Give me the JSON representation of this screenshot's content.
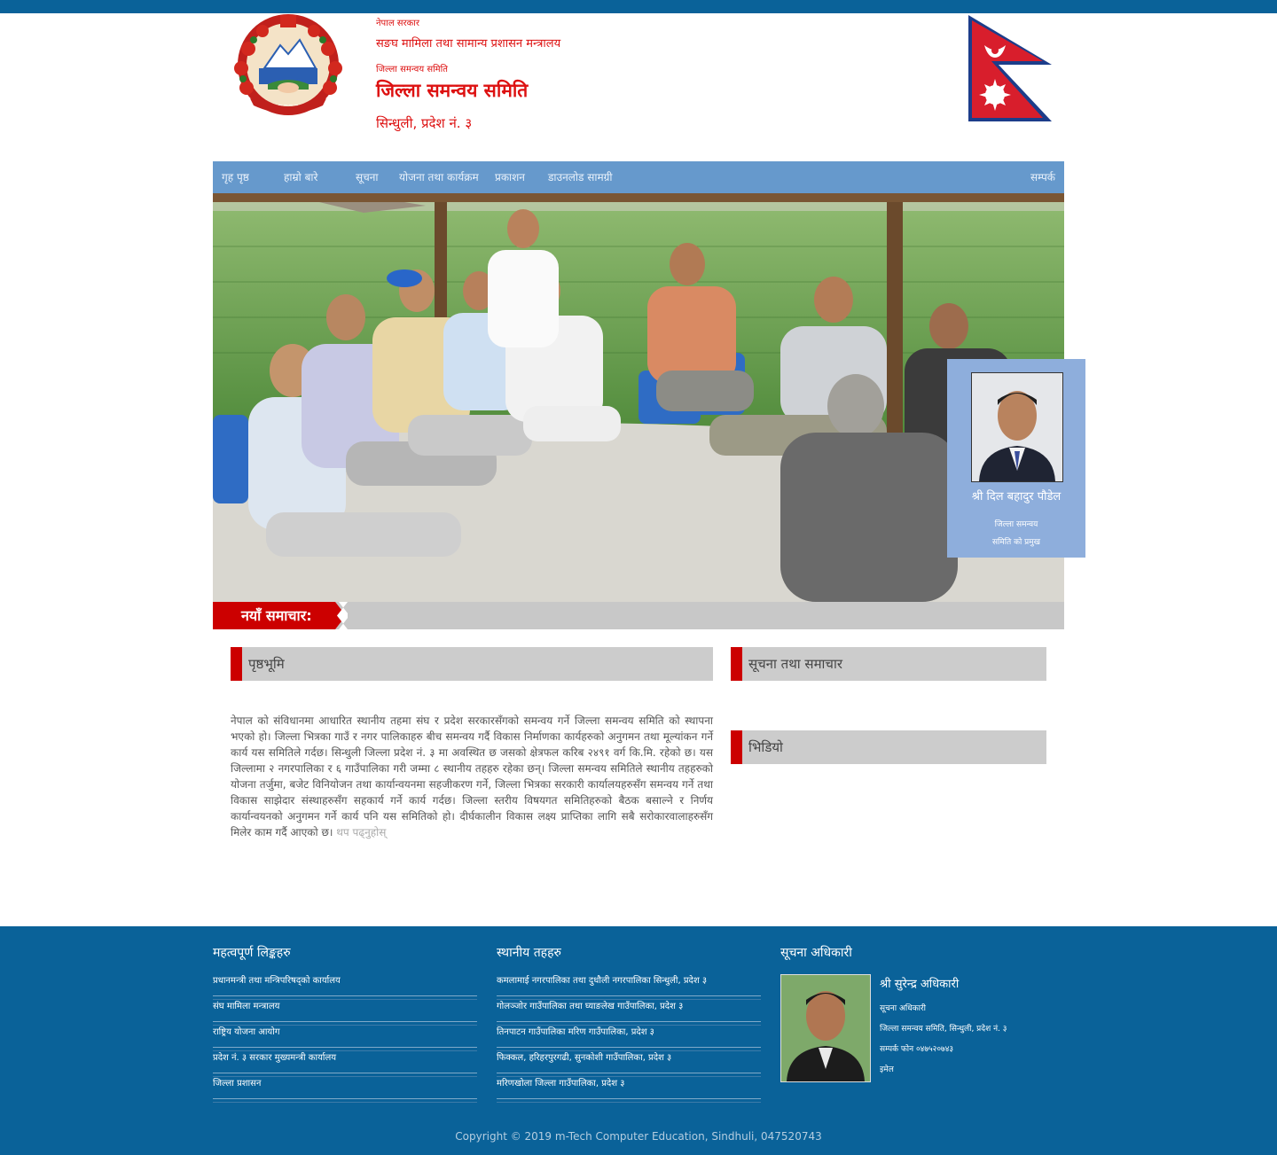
{
  "header": {
    "line1": "नेपाल सरकार",
    "line2": "सङघ मामिला तथा सामान्य प्रशासन मन्त्रालय",
    "line3": "जिल्ला समन्वय समिति",
    "title": "जिल्ला समन्वय समिति",
    "address": "सिन्धुली, प्रदेश नं. ३",
    "emblem_icon": "nepal-emblem-icon",
    "flag_icon": "nepal-flag-icon",
    "colors": {
      "text": "#dd1111",
      "topbar": "#0a6299"
    }
  },
  "nav": {
    "items": [
      "गृह पृष्ठ",
      "हाम्रो बारे",
      "सूचना",
      "योजना तथा कार्यक्रम",
      "प्रकाशन",
      "डाउनलोड सामग्री"
    ],
    "right": "सम्पर्क",
    "background": "#6699cc"
  },
  "profile": {
    "name": "श्री दिल बहादुर पौडेल",
    "position": "जिल्ला समन्वय",
    "org": "समिति को प्रमुख"
  },
  "news": {
    "label": "नयाँ समाचार:"
  },
  "sections": {
    "intro_title": "पृष्ठभूमि",
    "notices_title": "सूचना तथा समाचार",
    "video_title": "भिडियो"
  },
  "intro": {
    "text": "नेपाल को संविधानमा आधारित स्थानीय तहमा संघ र प्रदेश सरकारसँगको समन्वय गर्ने जिल्ला समन्वय समिति को स्थापना भएको हो। जिल्ला भित्रका गाउँ र नगर पालिकाहरु बीच समन्वय गर्दै विकास निर्माणका कार्यहरुको अनुगमन तथा मूल्यांकन गर्ने कार्य यस समितिले गर्दछ। सिन्धुली जिल्ला प्रदेश नं. ३ मा अवस्थित छ जसको क्षेत्रफल करिब २४९१ वर्ग कि.मि. रहेको छ। यस जिल्लामा २ नगरपालिका र ६ गाउँपालिका गरी जम्मा ८ स्थानीय तहहरु रहेका छन्। जिल्ला समन्वय समितिले स्थानीय तहहरुको योजना तर्जुमा, बजेट विनियोजन तथा कार्यान्वयनमा सहजीकरण गर्ने, जिल्ला भित्रका सरकारी कार्यालयहरुसँग समन्वय गर्ने तथा विकास साझेदार संस्थाहरुसँग सहकार्य गर्ने कार्य गर्दछ। जिल्ला स्तरीय विषयगत समितिहरुको बैठक बसाल्ने र निर्णय कार्यान्वयनको अनुगमन गर्ने कार्य पनि यस समितिको हो। दीर्घकालीन विकास लक्ष्य प्राप्तिका लागि सबै सरोकारवालाहरुसँग मिलेर काम गर्दै आएको छ।",
    "more": "थप पढ्नुहोस्"
  },
  "footer": {
    "col1_title": "महत्वपूर्ण लिङ्कहरु",
    "col1_links": [
      "प्रधानमन्त्री तथा मन्त्रिपरिषद्को कार्यालय",
      "संघ मामिला मन्त्रालय",
      "राष्ट्रिय योजना आयोग",
      "प्रदेश नं. ३ सरकार मुख्यमन्त्री कार्यालय",
      "जिल्ला प्रशासन"
    ],
    "col2_title": "स्थानीय तहहरु",
    "col2_links": [
      "कमलामाई नगरपालिका तथा दुधौली नगरपालिका सिन्धुली, प्रदेश ३",
      "गोलञ्जोर गाउँपालिका तथा घ्याङलेख गाउँपालिका, प्रदेश ३",
      "तिनपाटन गाउँपालिका मरिण गाउँपालिका, प्रदेश ३",
      "फिक्कल, हरिहरपुरगढी, सुनकोशी गाउँपालिका, प्रदेश ३",
      "मरिणखोला जिल्ला गाउँपालिका, प्रदेश ३"
    ],
    "col3_title": "सूचना अधिकारी",
    "officer_name": "श्री सुरेन्द्र अधिकारी",
    "officer_lines": [
      "सूचना अधिकारी",
      "जिल्ला समन्वय समिति, सिन्धुली, प्रदेश नं. ३",
      "सम्पर्क फोन ०४७५२०७४३",
      "इमेल"
    ],
    "copyright": "Copyright © 2019 m-Tech Computer Education, Sindhuli, 047520743"
  }
}
